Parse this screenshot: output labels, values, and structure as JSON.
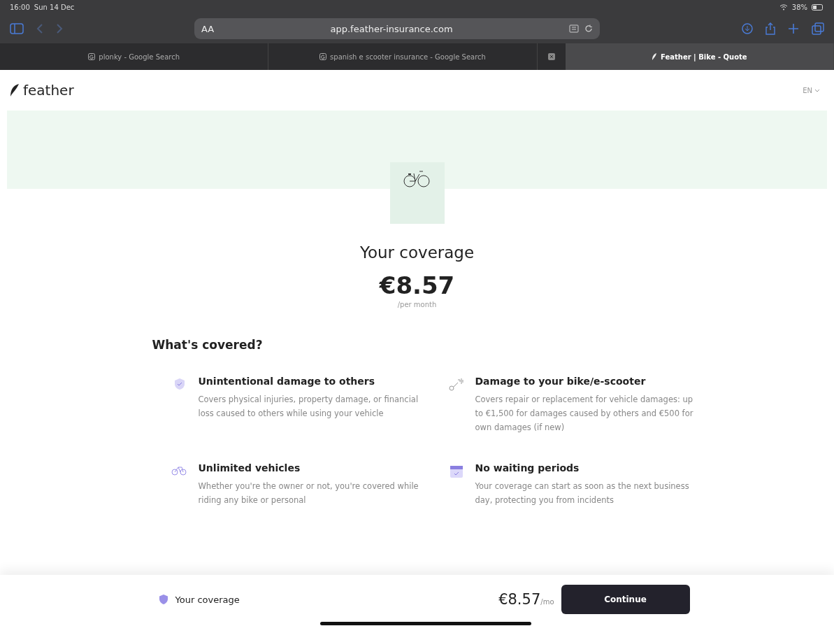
{
  "status_bar": {
    "time": "16:00",
    "date": "Sun 14 Dec",
    "battery": "38%"
  },
  "toolbar": {
    "text_size": "AA",
    "url": "app.feather-insurance.com"
  },
  "tabs": [
    {
      "label": "plonky - Google Search",
      "selected": false
    },
    {
      "label": "spanish e scooter insurance - Google Search",
      "selected": false
    },
    {
      "label": "Feather | Bike - Quote",
      "selected": true
    }
  ],
  "header": {
    "logo": "feather",
    "language": "EN"
  },
  "hero": {
    "title": "Your coverage",
    "price": "€8.57",
    "period": "/per month"
  },
  "covered": {
    "heading": "What's covered?",
    "items": [
      {
        "kind": "shield",
        "title": "Unintentional damage to others",
        "text": "Covers physical injuries, property damage, or financial loss caused to others while using your vehicle"
      },
      {
        "kind": "tools",
        "title": "Damage to your bike/e-scooter",
        "text": "Covers repair or replacement for vehicle damages: up to €1,500 for damages caused by others and €500 for own damages (if new)"
      },
      {
        "kind": "bikes",
        "title": "Unlimited vehicles",
        "text": "Whether you're the owner or not, you're covered while riding any bike or personal"
      },
      {
        "kind": "calendar",
        "title": "No waiting periods",
        "text": "Your coverage can start as soon as the next business day, protecting you from incidents"
      }
    ]
  },
  "footer": {
    "label": "Your coverage",
    "price": "€8.57",
    "unit": "/mo",
    "button": "Continue"
  }
}
